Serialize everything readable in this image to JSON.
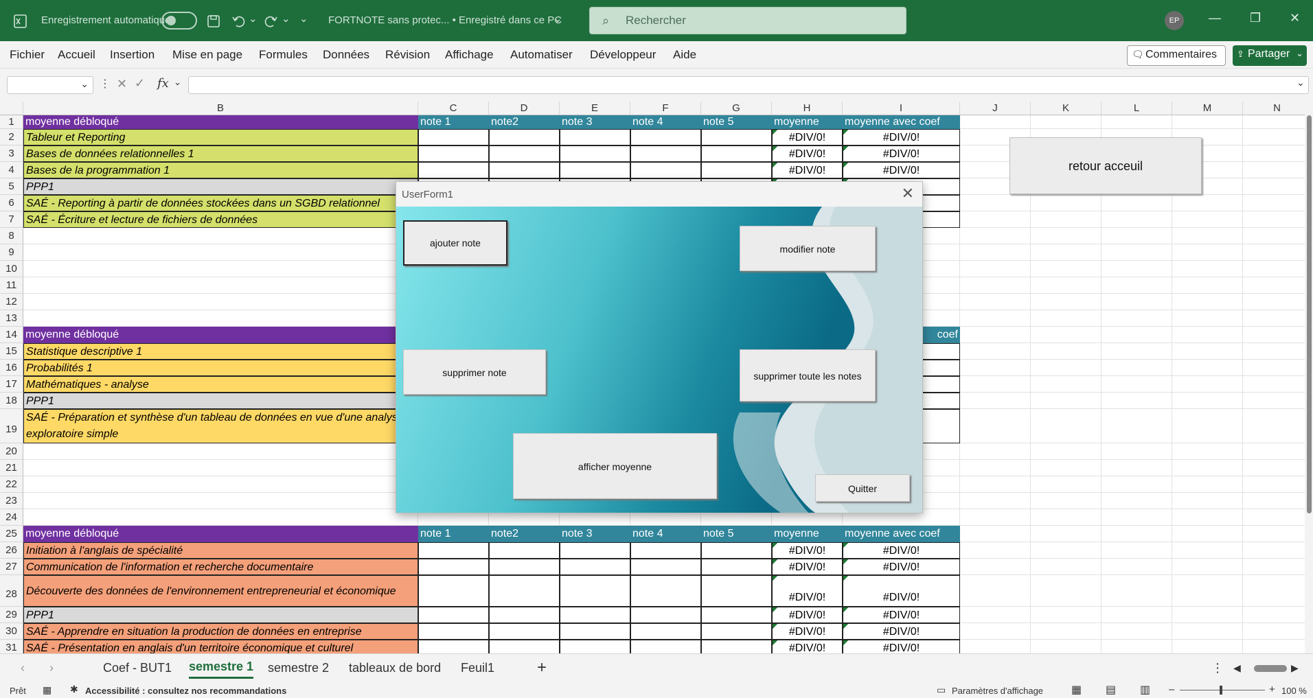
{
  "titlebar": {
    "autosave_label": "Enregistrement automatique",
    "file_title": "FORTNOTE sans protec... • Enregistré dans ce PC",
    "search_placeholder": "Rechercher",
    "user_initials": "EP"
  },
  "menubar": {
    "items": [
      "Fichier",
      "Accueil",
      "Insertion",
      "Mise en page",
      "Formules",
      "Données",
      "Révision",
      "Affichage",
      "Automatiser",
      "Développeur",
      "Aide"
    ],
    "comments_label": "Commentaires",
    "share_label": "Partager"
  },
  "formula": {
    "fx": "fx",
    "value": ""
  },
  "columns": [
    "B",
    "C",
    "D",
    "E",
    "F",
    "G",
    "H",
    "I",
    "J",
    "K",
    "L",
    "M",
    "N"
  ],
  "rows": [
    "1",
    "2",
    "3",
    "4",
    "5",
    "6",
    "7",
    "8",
    "9",
    "10",
    "11",
    "12",
    "13",
    "14",
    "15",
    "16",
    "17",
    "18",
    "19",
    "20",
    "21",
    "22",
    "23",
    "24",
    "25",
    "26",
    "27",
    "28",
    "29",
    "30",
    "31"
  ],
  "header_labels": {
    "title": "moyenne débloqué",
    "note1": "note 1",
    "note2": "note2",
    "note3": "note 3",
    "note4": "note 4",
    "note5": "note 5",
    "moyenne": "moyenne",
    "coef": "moyenne avec coef",
    "coef_partial": "coef"
  },
  "error_value": "#DIV/0!",
  "block1": [
    "Tableur et Reporting",
    "Bases de données relationnelles 1",
    "Bases de la programmation 1",
    "PPP1",
    "SAÉ - Reporting à partir de données stockées dans un SGBD relationnel",
    "SAÉ - Écriture et lecture de fichiers de données"
  ],
  "block2": [
    "Statistique descriptive 1",
    "Probabilités 1",
    "Mathématiques - analyse",
    "PPP1"
  ],
  "block2_last_line1": "SAÉ - Préparation et synthèse d'un tableau de données en vue d'une analyse",
  "block2_last_line2": "exploratoire simple",
  "block3": [
    "Initiation à l'anglais de spécialité",
    "Communication de l'information et recherche documentaire",
    "Découverte des données de l'environnement entrepreneurial et économique",
    "PPP1",
    "SAÉ - Apprendre en situation la production de données en entreprise",
    "SAÉ - Présentation en anglais d'un territoire économique et culturel"
  ],
  "retour_label": "retour acceuil",
  "userform": {
    "title": "UserForm1",
    "ajouter": "ajouter note",
    "modifier": "modifier note",
    "supprimer": "supprimer note",
    "supprimer_tout": "supprimer toute les notes",
    "afficher": "afficher moyenne",
    "quitter": "Quitter"
  },
  "tabs": [
    "Coef - BUT1",
    "semestre 1",
    "semestre 2",
    "tableaux de bord",
    "Feuil1"
  ],
  "active_tab": "semestre 1",
  "status": {
    "ready": "Prêt",
    "accessibility": "Accessibilité : consultez nos recommandations",
    "display_settings": "Paramètres d'affichage",
    "zoom": "100 %"
  },
  "colors": {
    "header_purple": "#7030a0",
    "header_blue": "#31869b",
    "green": "#d4e06b",
    "yellow": "#ffd966",
    "salmon": "#f4a07a",
    "gray": "#d9d9d9",
    "ribbon_green": "#1e6e3c"
  }
}
